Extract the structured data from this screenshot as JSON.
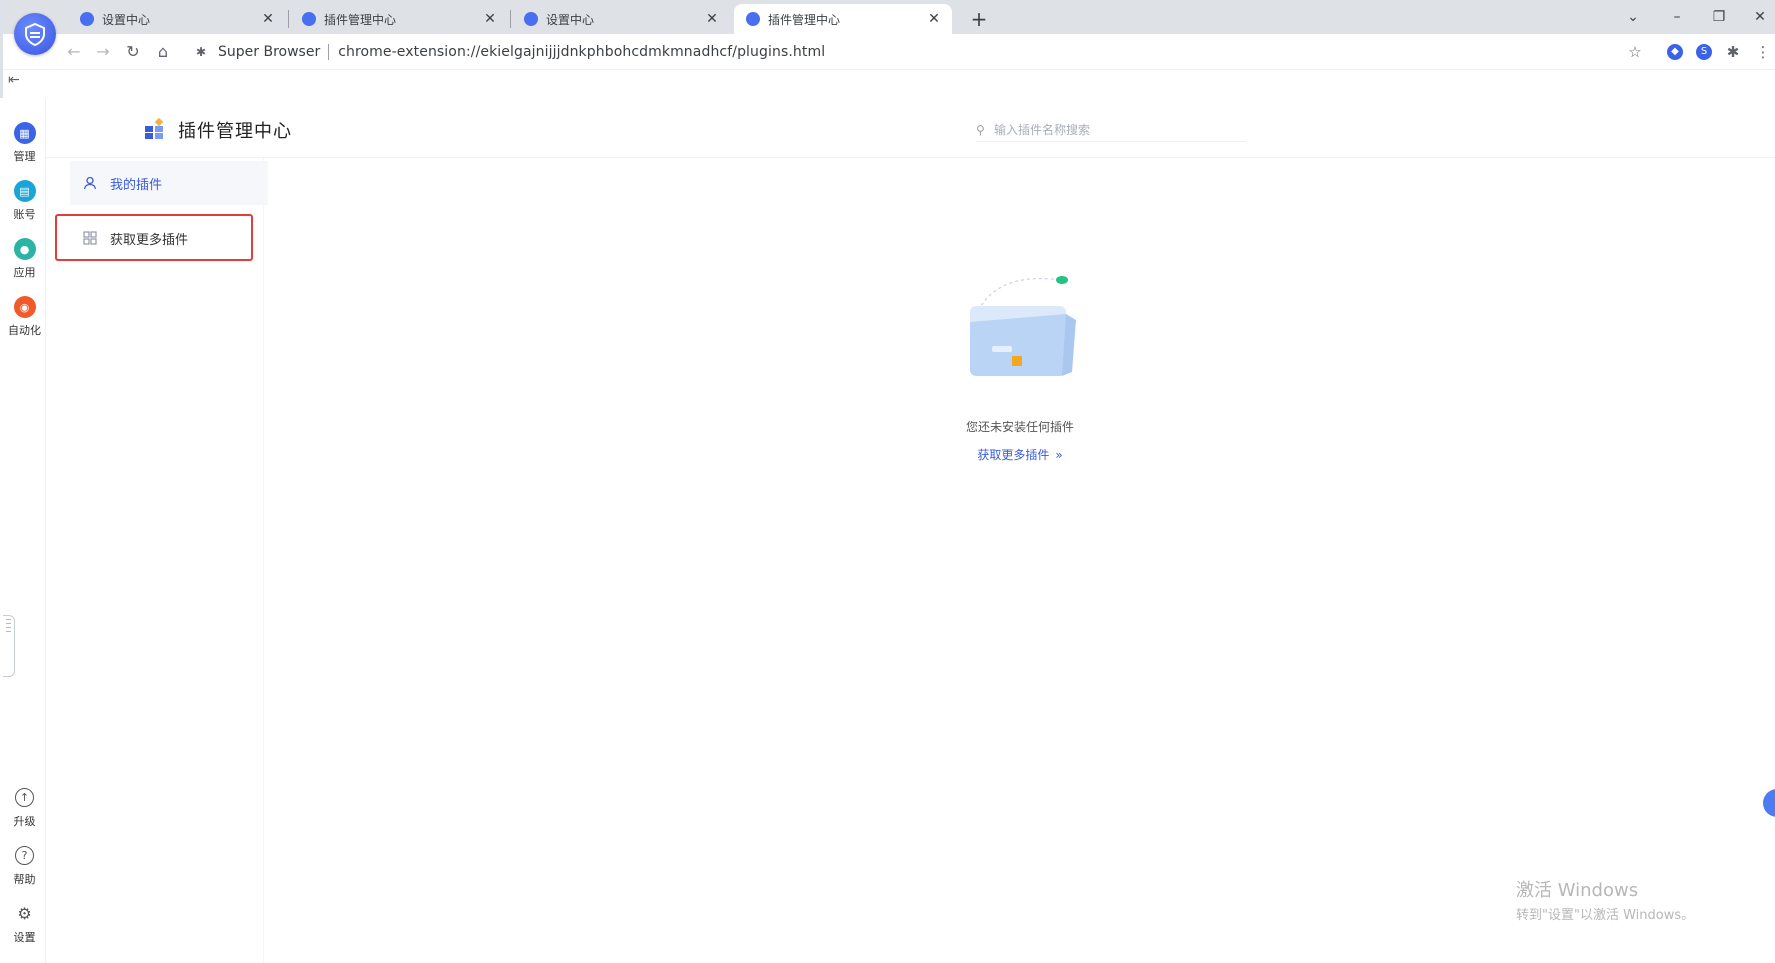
{
  "browser": {
    "tabs": [
      {
        "title": "设置中心"
      },
      {
        "title": "插件管理中心"
      },
      {
        "title": "设置中心"
      },
      {
        "title": "插件管理中心"
      }
    ],
    "omnibox": {
      "site": "Super Browser",
      "url": "chrome-extension://ekielgajnijjjdnkphbohcdmkmnadhcf/plugins.html"
    }
  },
  "rail": {
    "top_items": [
      {
        "label": "管理",
        "icon": "grid-icon",
        "color": "#3a63e8"
      },
      {
        "label": "账号",
        "icon": "store-icon",
        "color": "#1aa5d6"
      },
      {
        "label": "应用",
        "icon": "app-icon",
        "color": "#2bb3a3"
      },
      {
        "label": "自动化",
        "icon": "robot-icon",
        "color": "#f05a2a"
      }
    ],
    "bottom_items": [
      {
        "label": "升级",
        "icon": "upgrade-icon"
      },
      {
        "label": "帮助",
        "icon": "help-icon"
      },
      {
        "label": "设置",
        "icon": "gear-icon"
      }
    ]
  },
  "header": {
    "title": "插件管理中心",
    "search_placeholder": "输入插件名称搜索"
  },
  "menu": {
    "items": [
      {
        "label": "我的插件",
        "icon": "user-icon",
        "active": true
      },
      {
        "label": "获取更多插件",
        "icon": "apps-icon",
        "active": false
      }
    ]
  },
  "empty_state": {
    "message": "您还未安装任何插件",
    "link": "获取更多插件"
  },
  "watermark": {
    "title": "激活 Windows",
    "subtitle": "转到\"设置\"以激活 Windows。"
  },
  "colors": {
    "accent": "#3b5bdb",
    "highlight_border": "#e23d3d"
  }
}
